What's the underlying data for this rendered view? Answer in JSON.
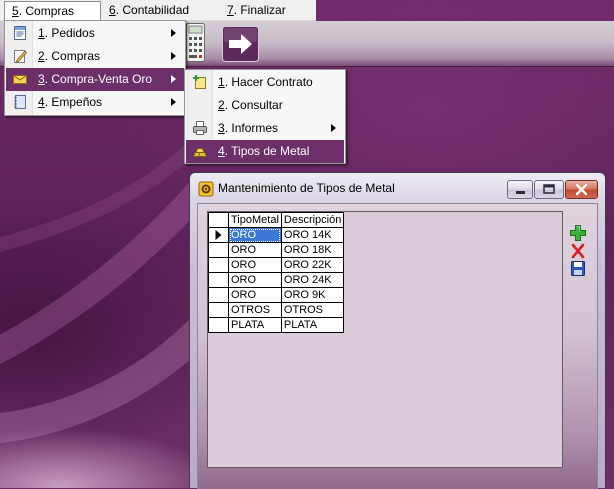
{
  "menubar": {
    "items": [
      {
        "mnemonic": "5",
        "rest": ". Compras",
        "open": true
      },
      {
        "mnemonic": "6",
        "rest": ". Contabilidad"
      },
      {
        "mnemonic": "7",
        "rest": ". Finalizar"
      }
    ]
  },
  "toolbar": {
    "buttons": [
      {
        "icon": "calculator-icon"
      },
      {
        "icon": "arrow-right-icon"
      }
    ]
  },
  "menu_compras": {
    "items": [
      {
        "mnemonic": "1",
        "rest": ". Pedidos",
        "icon": "document-list-icon",
        "has_submenu": true
      },
      {
        "mnemonic": "2",
        "rest": ". Compras",
        "icon": "edit-pencil-icon",
        "has_submenu": true
      },
      {
        "mnemonic": "3",
        "rest": ". Compra-Venta Oro",
        "icon": "gold-envelope-icon",
        "has_submenu": true,
        "highlighted": true
      },
      {
        "mnemonic": "4",
        "rest": ". Empeños",
        "icon": "notebook-icon",
        "has_submenu": true
      }
    ]
  },
  "menu_compra_venta_oro": {
    "items": [
      {
        "mnemonic": "1",
        "rest": ". Hacer Contrato",
        "icon": "new-contract-icon"
      },
      {
        "mnemonic": "2",
        "rest": ". Consultar"
      },
      {
        "mnemonic": "3",
        "rest": ". Informes",
        "icon": "printer-icon",
        "has_submenu": true
      },
      {
        "mnemonic": "4",
        "rest": ". Tipos de Metal",
        "icon": "gold-bars-icon",
        "highlighted": true
      }
    ]
  },
  "window": {
    "title": "Mantenimiento de Tipos de Metal",
    "icon": "gear-icon",
    "controls": [
      "minimize-icon",
      "maximize-icon",
      "close-icon"
    ],
    "grid": {
      "columns": [
        "TipoMetal",
        "Descripción"
      ],
      "rows": [
        {
          "tipo_metal": "ORO",
          "descripcion": "ORO 14K"
        },
        {
          "tipo_metal": "ORO",
          "descripcion": "ORO 18K"
        },
        {
          "tipo_metal": "ORO",
          "descripcion": "ORO 22K"
        },
        {
          "tipo_metal": "ORO",
          "descripcion": "ORO 24K"
        },
        {
          "tipo_metal": "ORO",
          "descripcion": "ORO 9K"
        },
        {
          "tipo_metal": "OTROS",
          "descripcion": "OTROS"
        },
        {
          "tipo_metal": "PLATA",
          "descripcion": "PLATA"
        }
      ],
      "current_row": 0,
      "selected_column": 0
    },
    "actions": [
      {
        "icon": "plus-icon",
        "color": "#36b336"
      },
      {
        "icon": "delete-x-icon",
        "color": "#d42020"
      },
      {
        "icon": "save-floppy-icon",
        "color": "#2f55c4"
      }
    ]
  },
  "colors": {
    "menu_highlight": "#6c2f6a",
    "menu_highlight_text": "#ffffff",
    "cell_selection": "#3b77d6",
    "desktop": "#5c2358",
    "grid_panel": "#dbcad8"
  }
}
